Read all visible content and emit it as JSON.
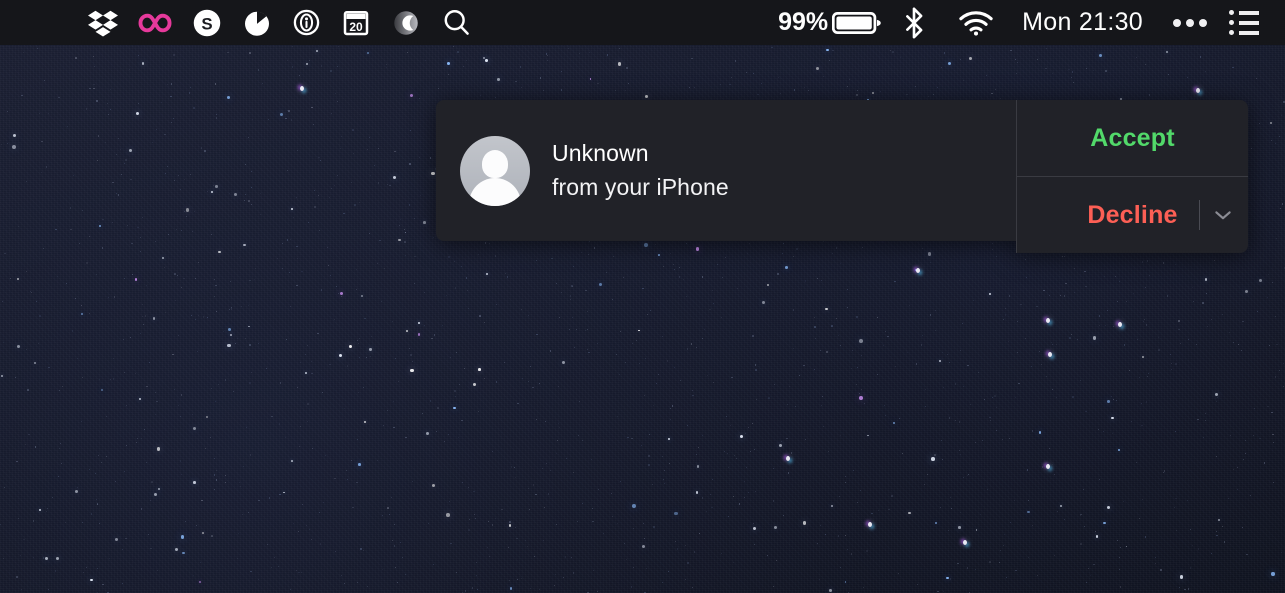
{
  "menubar": {
    "background_color": "#15161a",
    "status_items": [
      {
        "name": "dropbox-icon",
        "label": "Dropbox",
        "color": "#ffffff"
      },
      {
        "name": "infinity-icon",
        "label": "Infinity",
        "color": "#e6399b"
      },
      {
        "name": "skype-icon",
        "label": "Skype",
        "color": "#ffffff"
      },
      {
        "name": "timer-icon",
        "label": "Timer",
        "color": "#ffffff"
      },
      {
        "name": "info-circle-icon",
        "label": "Info",
        "color": "#ffffff"
      },
      {
        "name": "calendar-icon",
        "label": "Calendar",
        "color": "#ffffff",
        "day": "20"
      },
      {
        "name": "do-not-disturb-icon",
        "label": "Do Not Disturb",
        "color": "#c8c8cc"
      },
      {
        "name": "search-icon",
        "label": "Spotlight Search",
        "color": "#ffffff"
      }
    ],
    "battery": {
      "percent_label": "99%",
      "level": 0.99
    },
    "bluetooth": {
      "label": "Bluetooth"
    },
    "wifi": {
      "label": "Wi-Fi",
      "bars": 3
    },
    "clock": "Mon 21:30",
    "overflow": {
      "label": "More menu items"
    },
    "notification_center": {
      "label": "Notification Center"
    }
  },
  "notification": {
    "title": "Unknown",
    "subtitle": "from your iPhone",
    "avatar_name": "default-contact-avatar",
    "background_color": "#212228",
    "actions": {
      "accept": {
        "label": "Accept",
        "color": "#52d96a"
      },
      "decline": {
        "label": "Decline",
        "color": "#fd5f55"
      },
      "dropdown": {
        "name": "decline-options"
      }
    }
  },
  "desktop": {
    "wallpaper_name": "starfield-wallpaper",
    "base_color": "#141827"
  }
}
